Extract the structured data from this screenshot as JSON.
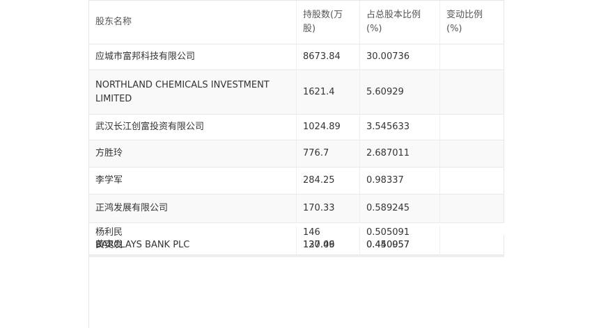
{
  "table": {
    "headers": [
      "股东名称",
      "持股数(万股)",
      "占总股本比例(%)",
      "变动比例(%)"
    ],
    "rows": [
      {
        "name": "应城市富邦科技有限公司",
        "shares": "8673.84",
        "ratio": "30.00736",
        "change": ""
      },
      {
        "name": "NORTHLAND CHEMICALS INVESTMENT LIMITED",
        "shares": "1621.4",
        "ratio": "5.60929",
        "change": ""
      },
      {
        "name": "武汉长江创富投资有限公司",
        "shares": "1024.89",
        "ratio": "3.545633",
        "change": ""
      },
      {
        "name": "方胜玲",
        "shares": "776.7",
        "ratio": "2.687011",
        "change": ""
      },
      {
        "name": "李学军",
        "shares": "284.25",
        "ratio": "0.98337",
        "change": ""
      },
      {
        "name": "正鸿发展有限公司",
        "shares": "170.33",
        "ratio": "0.589245",
        "change": ""
      }
    ],
    "overlapped_rows": [
      {
        "name": "杨利民",
        "shares": "146",
        "ratio": "0.505091",
        "change": ""
      },
      {
        "name": "BARCLAYS BANK PLC",
        "shares": "130.09",
        "ratio": "0.450057",
        "change": ""
      },
      {
        "name": "黄奕发",
        "shares": "127.46",
        "ratio": "0.440957",
        "change": ""
      }
    ]
  }
}
